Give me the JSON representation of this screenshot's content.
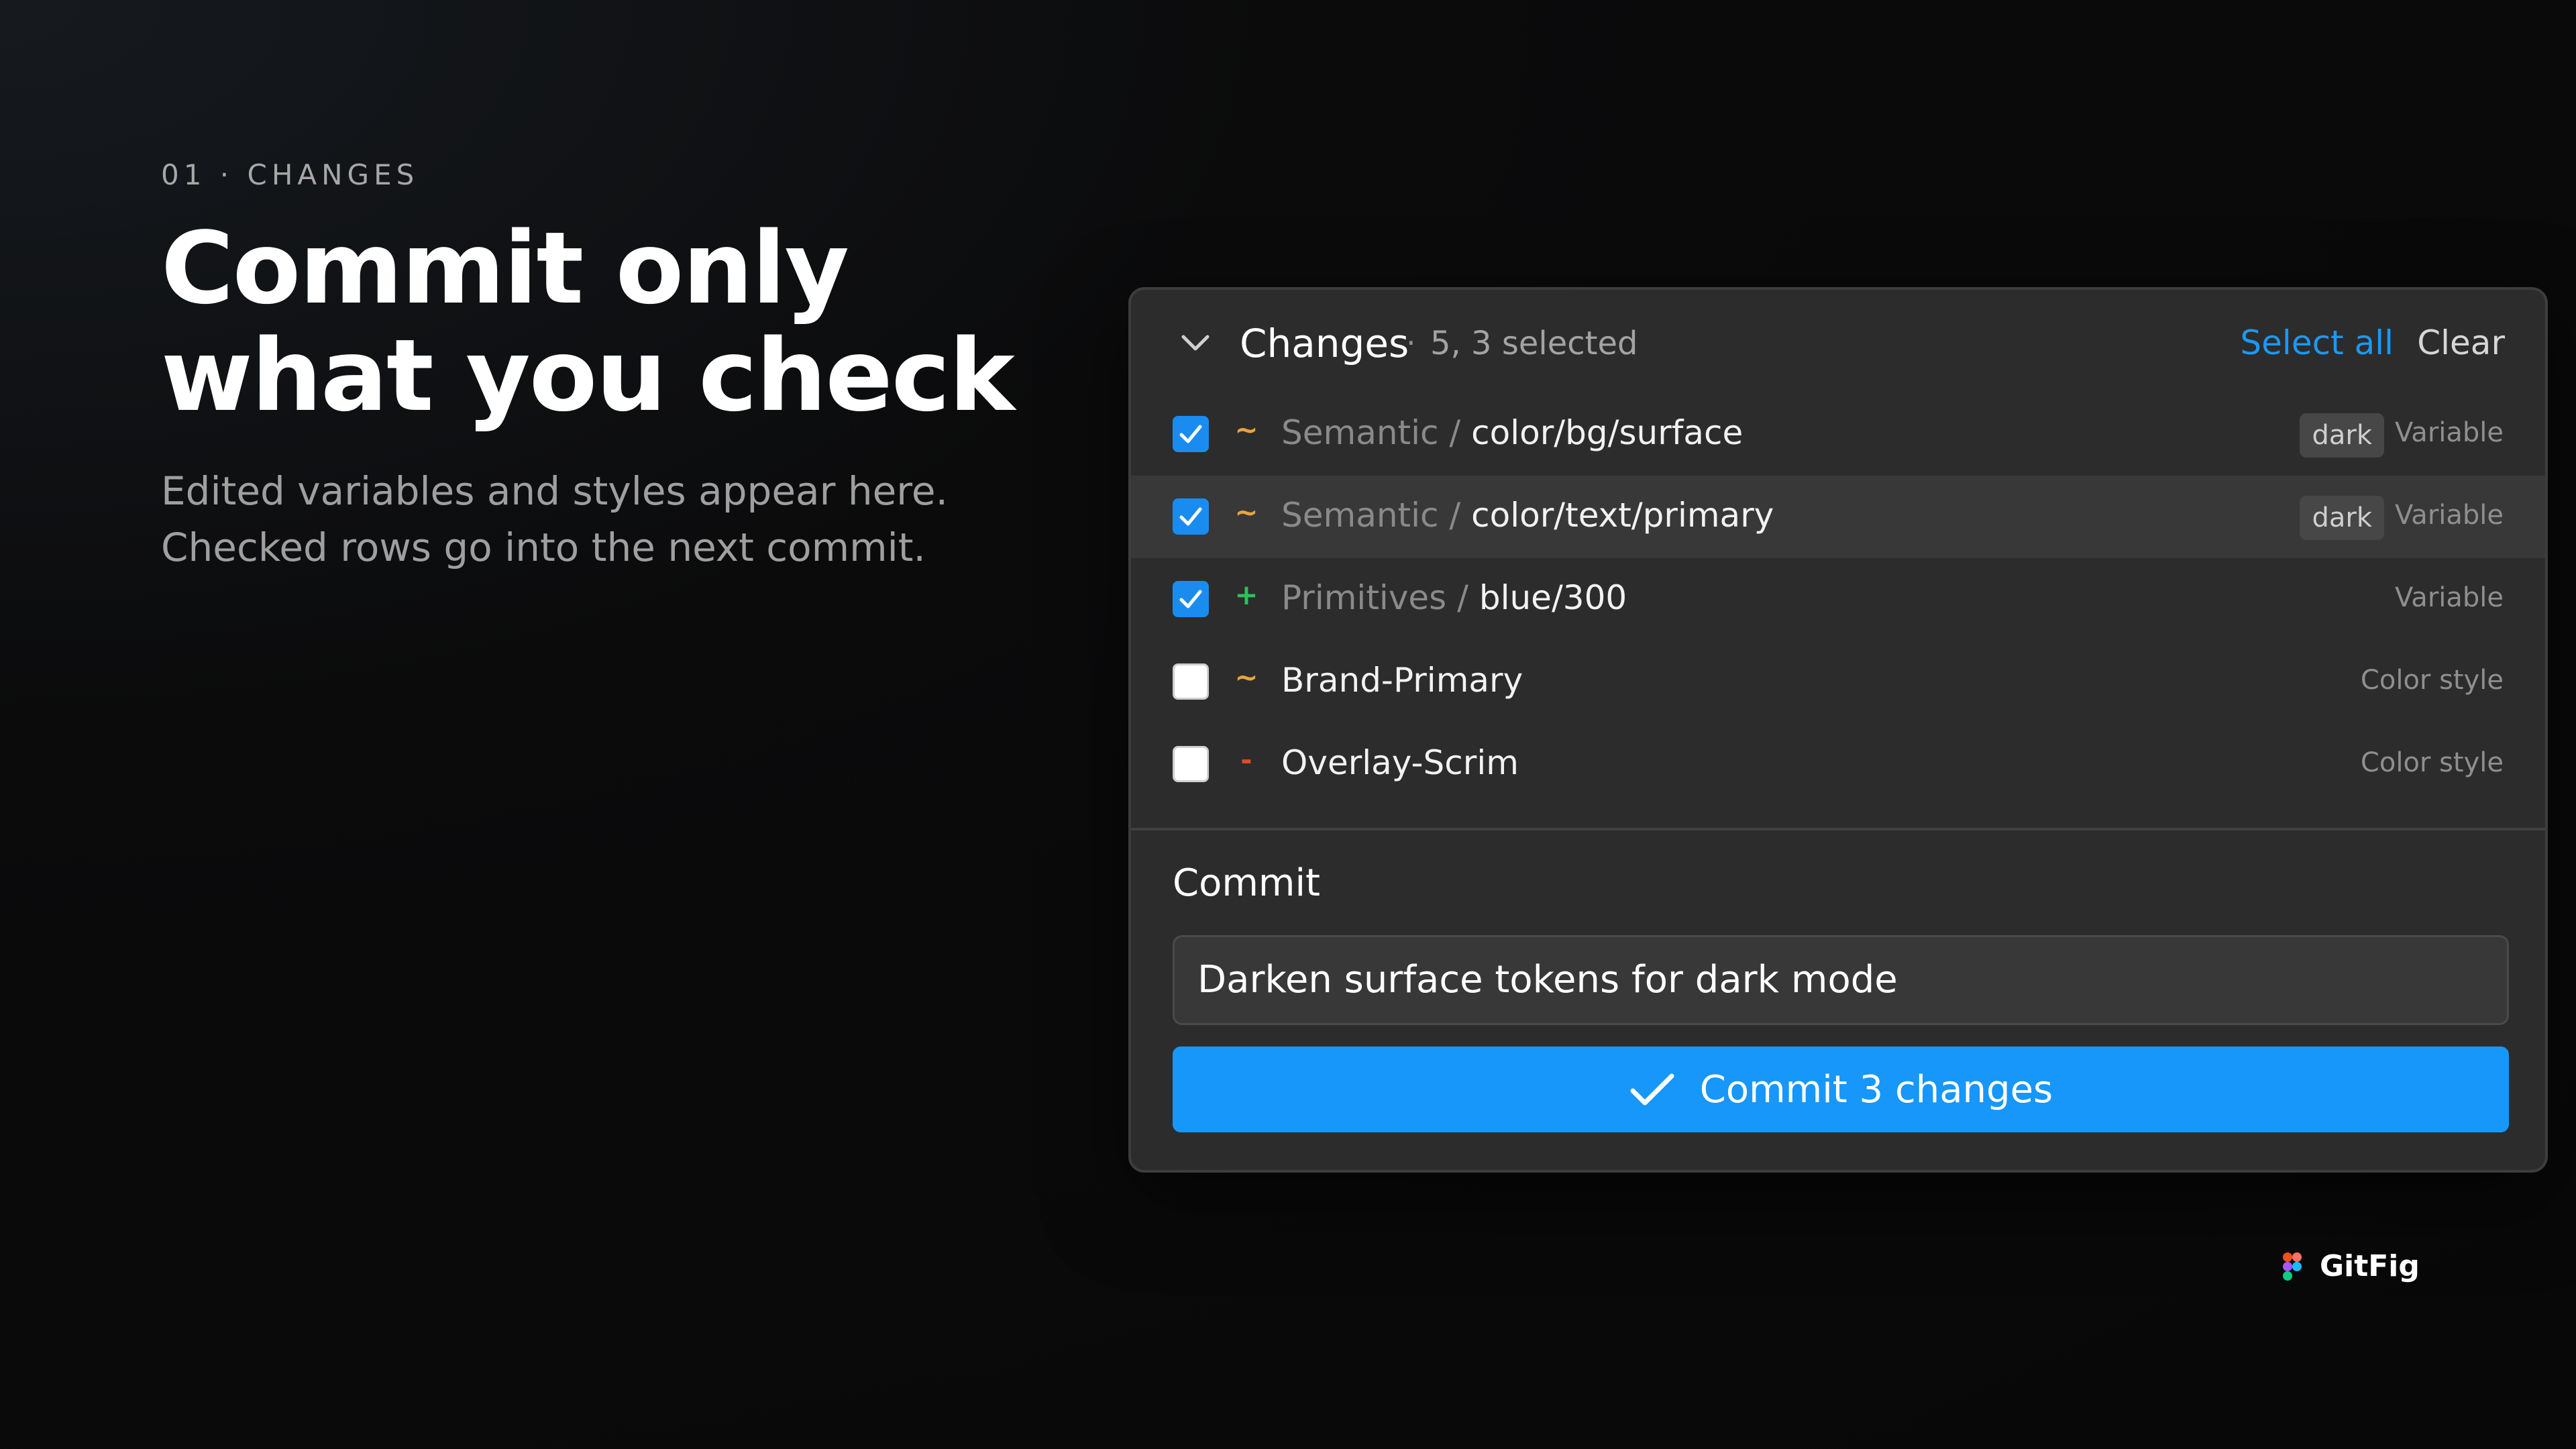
{
  "hero": {
    "eyebrow": "01 · CHANGES",
    "headline_lines": [
      "Commit only",
      "what you check"
    ],
    "subtitle_lines": [
      "Edited variables and styles appear here.",
      "Checked rows go into the next commit."
    ]
  },
  "panel": {
    "title": "Changes",
    "separator": "·",
    "count": "5, 3 selected",
    "select_all": "Select all",
    "clear": "Clear",
    "rows": [
      {
        "checked": true,
        "marker": "~",
        "marker_color": "#e8a33a",
        "group": "Semantic",
        "sep": " / ",
        "leaf": "color/bg/surface",
        "badge": "dark",
        "type": "Variable"
      },
      {
        "checked": true,
        "marker": "~",
        "marker_color": "#e8a33a",
        "group": "Semantic",
        "sep": " / ",
        "leaf": "color/text/primary",
        "badge": "dark",
        "type": "Variable"
      },
      {
        "checked": true,
        "marker": "+",
        "marker_color": "#2fbf5a",
        "group": "Primitives",
        "sep": " / ",
        "leaf": "blue/300",
        "badge": "",
        "type": "Variable"
      },
      {
        "checked": false,
        "marker": "~",
        "marker_color": "#e8a33a",
        "group": "",
        "sep": "",
        "leaf": "Brand-Primary",
        "badge": "",
        "type": "Color style"
      },
      {
        "checked": false,
        "marker": "-",
        "marker_color": "#e0482f",
        "group": "",
        "sep": "",
        "leaf": "Overlay-Scrim",
        "badge": "",
        "type": "Color style"
      }
    ],
    "commit_label": "Commit",
    "commit_message": "Darken surface tokens for dark mode",
    "commit_button": "Commit 3 changes"
  },
  "brand": {
    "name": "GitFig"
  },
  "colors": {
    "accent": "#1797fa",
    "link": "#1c98f5",
    "panel_bg": "#2c2c2c",
    "modified": "#e8a33a",
    "added": "#2fbf5a",
    "removed": "#e0482f"
  }
}
